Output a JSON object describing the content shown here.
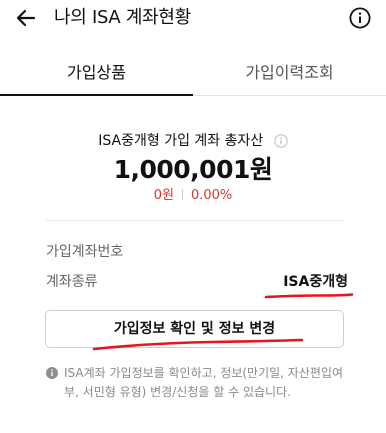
{
  "header": {
    "title": "나의 ISA 계좌현황",
    "back_icon": "arrow-left-icon",
    "info_icon": "info-circle-icon"
  },
  "tabs": [
    {
      "label": "가입상품",
      "active": true
    },
    {
      "label": "가입이력조회",
      "active": false
    }
  ],
  "summary": {
    "label": "ISA중개형 가입 계좌 총자산",
    "total_amount": "1,000,001원",
    "change_amount": "0원",
    "change_rate": "0.00%"
  },
  "account_info": {
    "account_number_label": "가입계좌번호",
    "account_type_label": "계좌종류",
    "account_type_value": "ISA중개형"
  },
  "action_button": {
    "label": "가입정보 확인 및 정보 변경"
  },
  "notice": {
    "text": "ISA계좌 가입정보를 확인하고, 정보(만기일, 자산편입여부, 서민형 유형) 변경/신청을 할 수 있습니다."
  },
  "colors": {
    "change_red": "#d23b35",
    "annotation_red": "#e8141e"
  }
}
